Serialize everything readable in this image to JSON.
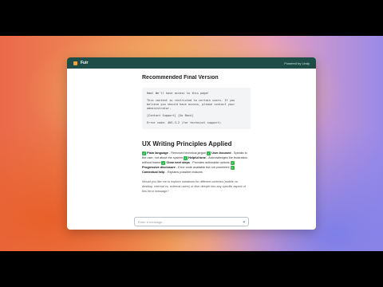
{
  "window": {
    "app_name": "Fuir",
    "powered_by": "Powered by Lindy"
  },
  "main": {
    "heading": "Recommended Final Version",
    "code_lines": [
      "Hmm! We'll have access to this page!",
      "",
      "This content is restricted to certain users. If you",
      "believe you should have access, please contact your",
      "administrator.",
      "",
      "[Contact Support] [Go Back]",
      "",
      "Error code: 403-3.2 (for technical support)"
    ],
    "principles_heading": "UX Writing Principles Applied",
    "principles": [
      {
        "title": "Plain language",
        "text": " - Removed technical jargon "
      },
      {
        "title": "User-focused",
        "text": " - Speaks to the user, not about the system "
      },
      {
        "title": "Helpful tone",
        "text": " - Acknowledges the frustration without blame "
      },
      {
        "title": "Clear next steps",
        "text": " - Provides actionable options "
      },
      {
        "title": "Progressive disclosure",
        "text": " - Error code available but not prominent "
      },
      {
        "title": "Contextual help",
        "text": " - Explains possible reasons"
      }
    ],
    "followup": "Would you like me to explore variations for different contexts (mobile vs. desktop, internal vs. external users) or dive deeper into any specific aspect of this error message?"
  },
  "composer": {
    "placeholder": "Enter a message..."
  },
  "colors": {
    "titlebar": "#1e4d48",
    "accent": "#2eb84b",
    "logo": "#f2a23a"
  }
}
